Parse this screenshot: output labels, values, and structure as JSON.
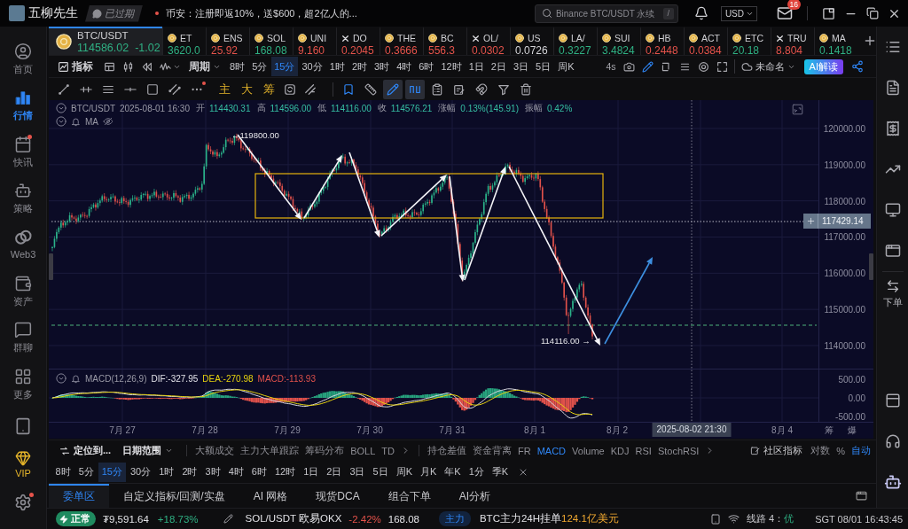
{
  "title_bar": {
    "user_name": "五柳先生",
    "account_status": "已过期",
    "announcement": "币安：注册即返10%，送$600，超2亿人的...",
    "search": {
      "placeholder": "Binance BTC/USDT 永续",
      "shortcut": "/"
    },
    "currency": "USD",
    "mail_count": "16"
  },
  "left_sidebar": {
    "items": [
      {
        "label": "首页",
        "selected": false,
        "notification": false
      },
      {
        "label": "行情",
        "selected": true,
        "notification": false
      },
      {
        "label": "快讯",
        "selected": false,
        "notification": true
      },
      {
        "label": "策略",
        "selected": false,
        "notification": false
      },
      {
        "label": "Web3",
        "selected": false,
        "notification": false
      },
      {
        "label": "资产",
        "selected": false,
        "notification": false
      },
      {
        "label": "群聊",
        "selected": false,
        "notification": false
      },
      {
        "label": "更多",
        "selected": false,
        "notification": false
      }
    ],
    "vip_label": "VIP",
    "settings_notification": true
  },
  "tickers": [
    {
      "symbol": "BTC/USDT",
      "price": "114586.02",
      "change": "-1.02",
      "color": "#2fb083",
      "kind": "coin",
      "selected": true
    },
    {
      "symbol": "ET",
      "price": "3620.0",
      "color": "#2fb083",
      "kind": "coin",
      "selected": false
    },
    {
      "symbol": "ENS",
      "price": "25.92",
      "color": "#e5534b",
      "kind": "coin",
      "selected": false
    },
    {
      "symbol": "SOL",
      "price": "168.08",
      "color": "#2fb083",
      "kind": "coin",
      "selected": false
    },
    {
      "symbol": "UNI",
      "price": "9.160",
      "color": "#e5534b",
      "kind": "coin",
      "selected": false
    },
    {
      "symbol": "DO",
      "price": "0.2045",
      "color": "#e5534b",
      "kind": "cross",
      "selected": false
    },
    {
      "symbol": "THE",
      "price": "0.3666",
      "color": "#e5534b",
      "kind": "coin",
      "selected": false
    },
    {
      "symbol": "BC",
      "price": "556.3",
      "color": "#e5534b",
      "kind": "coin",
      "selected": false
    },
    {
      "symbol": "OL/",
      "price": "0.0302",
      "color": "#e5534b",
      "kind": "cross",
      "selected": false
    },
    {
      "symbol": "US",
      "price": "0.0726",
      "color": "#d4d4d8",
      "kind": "coin",
      "selected": false
    },
    {
      "symbol": "LA/",
      "price": "0.3227",
      "color": "#2fb083",
      "kind": "coin",
      "selected": false
    },
    {
      "symbol": "SUI",
      "price": "3.4824",
      "color": "#2fb083",
      "kind": "coin",
      "selected": false
    },
    {
      "symbol": "HB",
      "price": "0.2448",
      "color": "#e5534b",
      "kind": "coin",
      "selected": false
    },
    {
      "symbol": "ACT",
      "price": "0.0384",
      "color": "#e5534b",
      "kind": "coin",
      "selected": false
    },
    {
      "symbol": "ETC",
      "price": "20.18",
      "color": "#2fb083",
      "kind": "coin",
      "selected": false
    },
    {
      "symbol": "TRU",
      "price": "8.804",
      "color": "#e5534b",
      "kind": "cross",
      "selected": false
    },
    {
      "symbol": "MA",
      "price": "0.1418",
      "color": "#2fb083",
      "kind": "coin",
      "selected": false
    }
  ],
  "chart_toolbar": {
    "indicator_label": "指标",
    "period_label": "周期",
    "intervals": [
      {
        "label": "8时",
        "selected": false
      },
      {
        "label": "5分",
        "selected": false
      },
      {
        "label": "15分",
        "selected": true
      },
      {
        "label": "30分",
        "selected": false
      },
      {
        "label": "1时",
        "selected": false
      },
      {
        "label": "2时",
        "selected": false
      },
      {
        "label": "3时",
        "selected": false
      },
      {
        "label": "4时",
        "selected": false
      },
      {
        "label": "6时",
        "selected": false
      },
      {
        "label": "12时",
        "selected": false
      },
      {
        "label": "1日",
        "selected": false
      },
      {
        "label": "2日",
        "selected": false
      },
      {
        "label": "3日",
        "selected": false
      },
      {
        "label": "5日",
        "selected": false
      },
      {
        "label": "周K",
        "selected": false
      }
    ],
    "refresh_rate": "4s",
    "layout_name": "未命名",
    "ai_button": "AI解读"
  },
  "drawing_toolbar": {
    "more_notification": true,
    "text_tools": [
      "主",
      "大",
      "筹"
    ],
    "tools": [
      {
        "selected": false
      },
      {
        "selected": false
      },
      {
        "selected": true
      },
      {
        "selected": true
      },
      {
        "selected": false
      },
      {
        "selected": false
      },
      {
        "selected": false
      },
      {
        "selected": false
      },
      {
        "selected": false
      }
    ]
  },
  "chart": {
    "symbol": "BTC/USDT",
    "datetime": "2025-08-01 16:30",
    "quote": [
      {
        "label": "开",
        "value": "114430.31"
      },
      {
        "label": "高",
        "value": "114596.00"
      },
      {
        "label": "低",
        "value": "114116.00"
      },
      {
        "label": "收",
        "value": "114576.21"
      },
      {
        "label": "涨幅",
        "value": "0.13%(145.91)"
      },
      {
        "label": "振幅",
        "value": "0.42%"
      }
    ],
    "overlay_label": "MA",
    "high_marker": "←119800.00",
    "low_marker": "114116.00 →",
    "price_axis": [
      "120000.00",
      "119000.00",
      "118000.00",
      "117000.00",
      "116000.00",
      "115000.00",
      "114000.00"
    ],
    "current_price": "117429.14",
    "macd": {
      "name": "MACD(12,26,9)",
      "dif": "DIF:-327.95",
      "dea": "DEA:-270.98",
      "value": "MACD:-113.93",
      "axis": [
        "500.00",
        "0.00",
        "-500.00"
      ]
    },
    "date_axis": [
      "7月 27",
      "7月 28",
      "7月 29",
      "7月 30",
      "7月 31",
      "8月 1",
      "8月 2",
      "8月 4"
    ],
    "crosshair_date": "2025-08-02 21:30",
    "axis_corner": [
      "筹",
      "爆"
    ]
  },
  "indicator_bar": {
    "locate": "定位到...",
    "date_range": "日期范围",
    "tools": [
      "大额成交",
      "主力大单跟踪",
      "筹码分布",
      "BOLL",
      "TD"
    ],
    "indicators": [
      {
        "label": "持仓差值",
        "selected": false
      },
      {
        "label": "资金背离",
        "selected": false
      },
      {
        "label": "FR",
        "selected": false
      },
      {
        "label": "MACD",
        "selected": true
      },
      {
        "label": "Volume",
        "selected": false
      },
      {
        "label": "KDJ",
        "selected": false
      },
      {
        "label": "RSI",
        "selected": false
      },
      {
        "label": "StochRSI",
        "selected": false
      }
    ],
    "community": "社区指标",
    "options": [
      {
        "label": "对数",
        "selected": false
      },
      {
        "label": "%",
        "selected": false
      },
      {
        "label": "自动",
        "selected": true
      }
    ]
  },
  "interval_bar": [
    {
      "label": "8时",
      "selected": false
    },
    {
      "label": "5分",
      "selected": false
    },
    {
      "label": "15分",
      "selected": true
    },
    {
      "label": "30分",
      "selected": false
    },
    {
      "label": "1时",
      "selected": false
    },
    {
      "label": "2时",
      "selected": false
    },
    {
      "label": "3时",
      "selected": false
    },
    {
      "label": "4时",
      "selected": false
    },
    {
      "label": "6时",
      "selected": false
    },
    {
      "label": "12时",
      "selected": false
    },
    {
      "label": "1日",
      "selected": false
    },
    {
      "label": "2日",
      "selected": false
    },
    {
      "label": "3日",
      "selected": false
    },
    {
      "label": "5日",
      "selected": false
    },
    {
      "label": "周K",
      "selected": false
    },
    {
      "label": "月K",
      "selected": false
    },
    {
      "label": "年K",
      "selected": false
    },
    {
      "label": "1分",
      "selected": false
    },
    {
      "label": "季K",
      "selected": false
    }
  ],
  "bottom_tabs": [
    {
      "label": "委单区",
      "selected": true
    },
    {
      "label": "自定义指标/回测/实盘",
      "selected": false
    },
    {
      "label": "AI 网格",
      "selected": false
    },
    {
      "label": "现货DCA",
      "selected": false
    },
    {
      "label": "组合下单",
      "selected": false
    },
    {
      "label": "AI分析",
      "selected": false
    }
  ],
  "right_sidebar": {
    "order_label": "下单"
  },
  "status_bar": {
    "connection": "正常",
    "balance": "₮9,591.64",
    "balance_change": "+18.73%",
    "pair": "SOL/USDT 欧易OKX",
    "pair_change": "-2.42%",
    "pair_price": "168.08",
    "tag": "主力",
    "order_label": "BTC主力24H挂单",
    "order_value": "124.1亿美元",
    "line_label": "线路 4：",
    "line_quality": "优",
    "clock": "SGT 08/01 16:43:45"
  }
}
